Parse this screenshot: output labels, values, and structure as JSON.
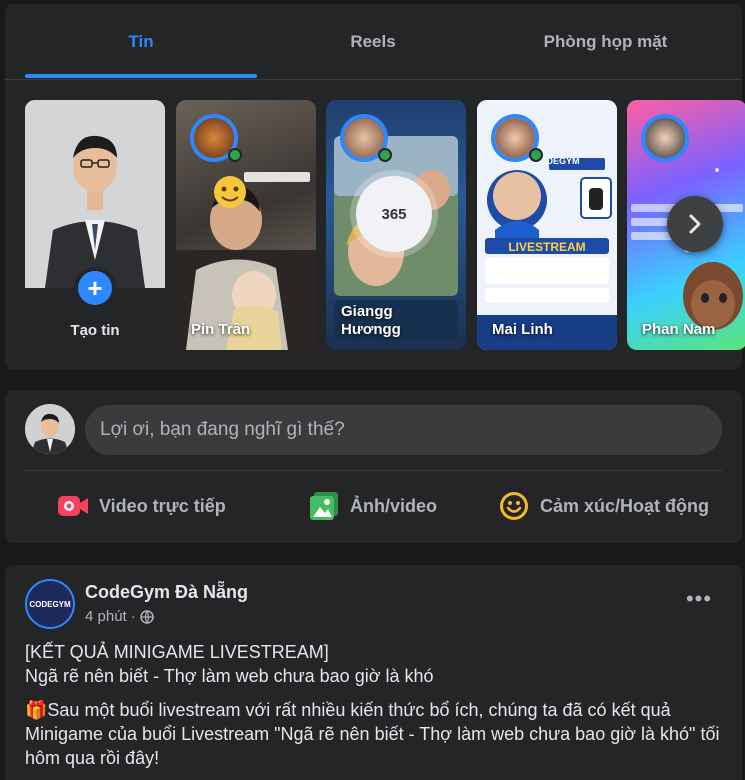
{
  "tabs": [
    {
      "label": "Tin",
      "active": true
    },
    {
      "label": "Reels",
      "active": false
    },
    {
      "label": "Phòng họp mặt",
      "active": false
    }
  ],
  "stories": {
    "create_label": "Tạo tin",
    "items": [
      {
        "name": "Pin Trần"
      },
      {
        "name": "Giangg\nHươngg",
        "overlay_number": "365"
      },
      {
        "name": "Mai Linh",
        "overlay_text": "LIVESTREAM",
        "overlay_sub": "CODEGYM"
      },
      {
        "name": "Phan Nam"
      }
    ]
  },
  "composer": {
    "placeholder": "Lợi ơi, bạn đang nghĩ gì thế?",
    "actions": [
      {
        "label": "Video trực tiếp",
        "icon": "live-video-icon",
        "color": "#f3425f"
      },
      {
        "label": "Ảnh/video",
        "icon": "photo-icon",
        "color": "#45bd62"
      },
      {
        "label": "Cảm xúc/Hoạt động",
        "icon": "feeling-icon",
        "color": "#f7b928"
      }
    ]
  },
  "post": {
    "author": "CodeGym Đà Nẵng",
    "avatar_text": "CODEGYM",
    "time": "4 phút",
    "more": "•••",
    "line1": "[KẾT QUẢ MINIGAME LIVESTREAM]",
    "line2": "Ngã rẽ nên biết - Thợ làm web chưa bao giờ là khó",
    "line3": "🎁Sau một buổi livestream với rất nhiều kiến thức bổ ích, chúng ta đã có kết quả Minigame của buổi Livestream \"Ngã rẽ nên biết - Thợ làm web chưa bao giờ là khó\" tối hôm qua rồi đây!"
  },
  "colors": {
    "accent": "#2d88ff",
    "card": "#242526",
    "background": "#18191a"
  }
}
